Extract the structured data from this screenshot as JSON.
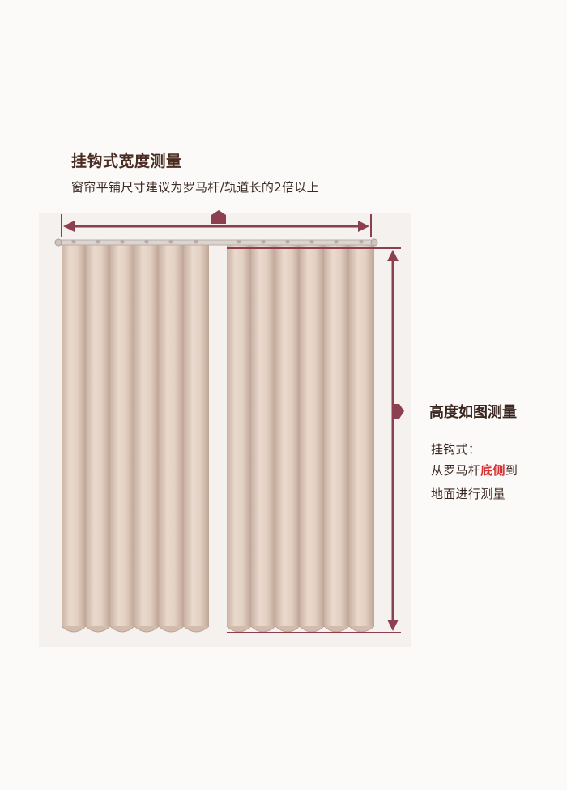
{
  "width_section": {
    "title": "挂钩式宽度测量",
    "subtitle": "窗帘平铺尺寸建议为罗马杆/轨道长的2倍以上"
  },
  "height_section": {
    "title": "高度如图测量",
    "line1": "挂钩式：",
    "line2_prefix": "从罗马杆",
    "line2_highlight": "底侧",
    "line2_suffix": "到",
    "line3": "地面进行测量"
  },
  "colors": {
    "arrow": "#8c3f4e",
    "curtain": "#d8c5b9",
    "highlight": "#d83030"
  }
}
